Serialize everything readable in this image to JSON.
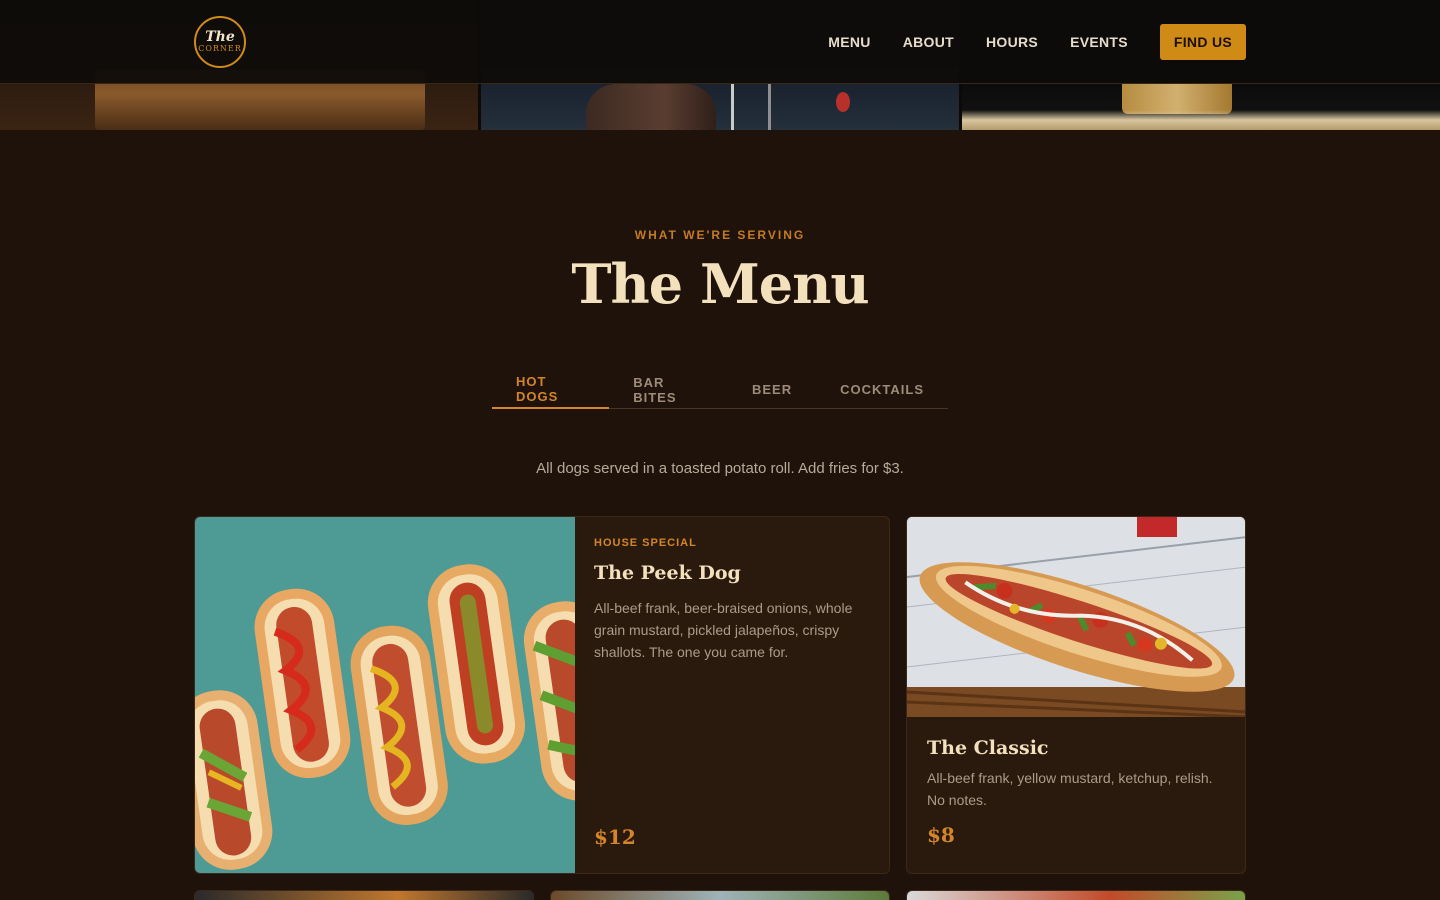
{
  "brand": {
    "logo_top": "The",
    "logo_bottom": "CORNER",
    "accent_color": "#d08a16"
  },
  "nav": {
    "links": [
      "MENU",
      "ABOUT",
      "HOURS",
      "EVENTS"
    ],
    "cta_label": "FIND US"
  },
  "menu": {
    "eyebrow": "WHAT WE'RE SERVING",
    "title": "The Menu",
    "tabs": [
      {
        "label": "HOT DOGS",
        "active": true
      },
      {
        "label": "BAR BITES",
        "active": false
      },
      {
        "label": "BEER",
        "active": false
      },
      {
        "label": "COCKTAILS",
        "active": false
      }
    ],
    "note": "All dogs served in a toasted potato roll. Add fries for $3."
  },
  "items": [
    {
      "badge": "HOUSE SPECIAL",
      "name": "The Peek Dog",
      "description": "All-beef frank, beer-braised onions, whole grain mustard, pickled jalapeños, crispy shallots. The one you came for.",
      "price": "$12",
      "image_icon": "hot-dogs-row-image"
    },
    {
      "badge": "",
      "name": "The Classic",
      "description": "All-beef frank, yellow mustard, ketchup, relish. No notes.",
      "price": "$8",
      "image_icon": "loaded-hot-dog-image"
    }
  ]
}
